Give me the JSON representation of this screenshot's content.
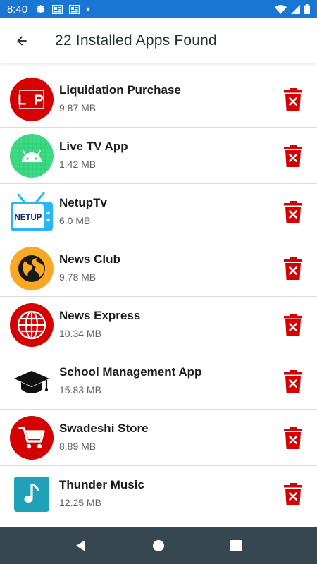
{
  "status_bar": {
    "time": "8:40",
    "left_icons": [
      "gear-icon",
      "news-icon",
      "news-icon",
      "dot-icon"
    ],
    "right_icons": [
      "wifi-icon",
      "signal-icon",
      "battery-icon"
    ],
    "background": "#1976d2"
  },
  "header": {
    "title": "22 Installed Apps Found",
    "back_icon": "arrow-back-icon"
  },
  "apps": [
    {
      "name": "Liquidation Purchase",
      "size": "9.87 MB",
      "icon": "lp-logo",
      "icon_text": "L P"
    },
    {
      "name": "Live TV App",
      "size": "1.42 MB",
      "icon": "android-robot-icon"
    },
    {
      "name": "NetupTv",
      "size": "6.0 MB",
      "icon": "tv-icon",
      "icon_text": "NETUP"
    },
    {
      "name": "News Club",
      "size": "9.78 MB",
      "icon": "globe-icon"
    },
    {
      "name": "News Express",
      "size": "10.34 MB",
      "icon": "globe-grid-icon"
    },
    {
      "name": "School Management App",
      "size": "15.83 MB",
      "icon": "graduation-cap-icon"
    },
    {
      "name": "Swadeshi Store",
      "size": "8.89 MB",
      "icon": "cart-icon"
    },
    {
      "name": "Thunder Music",
      "size": "12.25 MB",
      "icon": "music-note-icon"
    }
  ],
  "delete_icon": "trash-delete-icon",
  "nav_bar": {
    "buttons": [
      "back-triangle-icon",
      "home-circle-icon",
      "recents-square-icon"
    ],
    "background": "#37474f"
  },
  "colors": {
    "accent_red": "#d50000",
    "android_green": "#3ddc84",
    "news_orange": "#f9a825",
    "tv_blue": "#4fc3f7",
    "music_teal": "#26a69a"
  }
}
